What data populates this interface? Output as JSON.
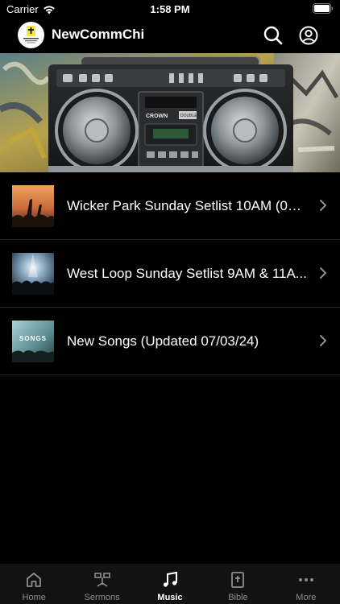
{
  "status_bar": {
    "carrier": "Carrier",
    "time": "1:58 PM"
  },
  "header": {
    "title": "NewCommChi",
    "logo_icon": "church-logo-icon",
    "search_icon": "search-icon",
    "profile_icon": "profile-icon"
  },
  "banner": {
    "image": "boombox-graffiti-image",
    "brand_text": "CROWN",
    "deck_text": "DOUBLE"
  },
  "playlists": [
    {
      "title": "Wicker Park Sunday Setlist 10AM (06/...",
      "thumb": "crowd-worship-thumb"
    },
    {
      "title": "West Loop Sunday Setlist 9AM & 11A...",
      "thumb": "concert-lights-thumb"
    },
    {
      "title": "New Songs (Updated 07/03/24)",
      "thumb": "new-songs-thumb",
      "thumb_text": "SONGS"
    }
  ],
  "tabs": [
    {
      "label": "Home",
      "icon": "home-icon",
      "active": false
    },
    {
      "label": "Sermons",
      "icon": "sermons-icon",
      "active": false
    },
    {
      "label": "Music",
      "icon": "music-icon",
      "active": true
    },
    {
      "label": "Bible",
      "icon": "bible-icon",
      "active": false
    },
    {
      "label": "More",
      "icon": "more-icon",
      "active": false
    }
  ],
  "colors": {
    "background": "#000000",
    "tab_bar": "#121212",
    "tab_inactive": "#8e8e93",
    "tab_active": "#ffffff",
    "divider": "#2a2a2a"
  }
}
